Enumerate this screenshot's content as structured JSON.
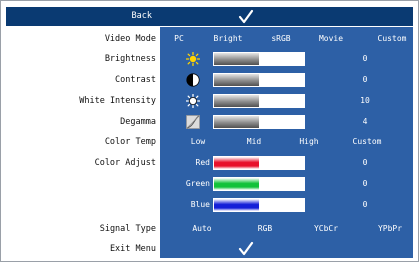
{
  "header": {
    "back_label": "Back"
  },
  "menu": {
    "video_mode": {
      "label": "Video Mode",
      "options": [
        "PC",
        "Bright",
        "sRGB",
        "Movie",
        "Custom"
      ]
    },
    "brightness": {
      "label": "Brightness",
      "value": "0",
      "level": 0.5
    },
    "contrast": {
      "label": "Contrast",
      "value": "0",
      "level": 0.5
    },
    "white_intensity": {
      "label": "White Intensity",
      "value": "10",
      "level": 0.5
    },
    "degamma": {
      "label": "Degamma",
      "value": "4",
      "level": 0.5
    },
    "color_temp": {
      "label": "Color Temp",
      "options": [
        "Low",
        "Mid",
        "High",
        "Custom"
      ]
    },
    "color_adjust": {
      "label": "Color Adjust",
      "channels": [
        {
          "label": "Red",
          "value": "0",
          "color": "#e8102a",
          "level": 0.5
        },
        {
          "label": "Green",
          "value": "0",
          "color": "#12c23a",
          "level": 0.5
        },
        {
          "label": "Blue",
          "value": "0",
          "color": "#1420d8",
          "level": 0.5
        }
      ]
    },
    "signal_type": {
      "label": "Signal Type",
      "options": [
        "Auto",
        "RGB",
        "YCbCr",
        "YPbPr"
      ]
    },
    "exit_menu": {
      "label": "Exit Menu"
    }
  },
  "colors": {
    "header": "#0a3a72",
    "panel": "#2d60a6",
    "text_light": "#ffffff",
    "text_dark": "#111111"
  },
  "icons": [
    "checkmark-icon",
    "sun-icon",
    "contrast-icon",
    "white-intensity-icon",
    "degamma-icon"
  ]
}
